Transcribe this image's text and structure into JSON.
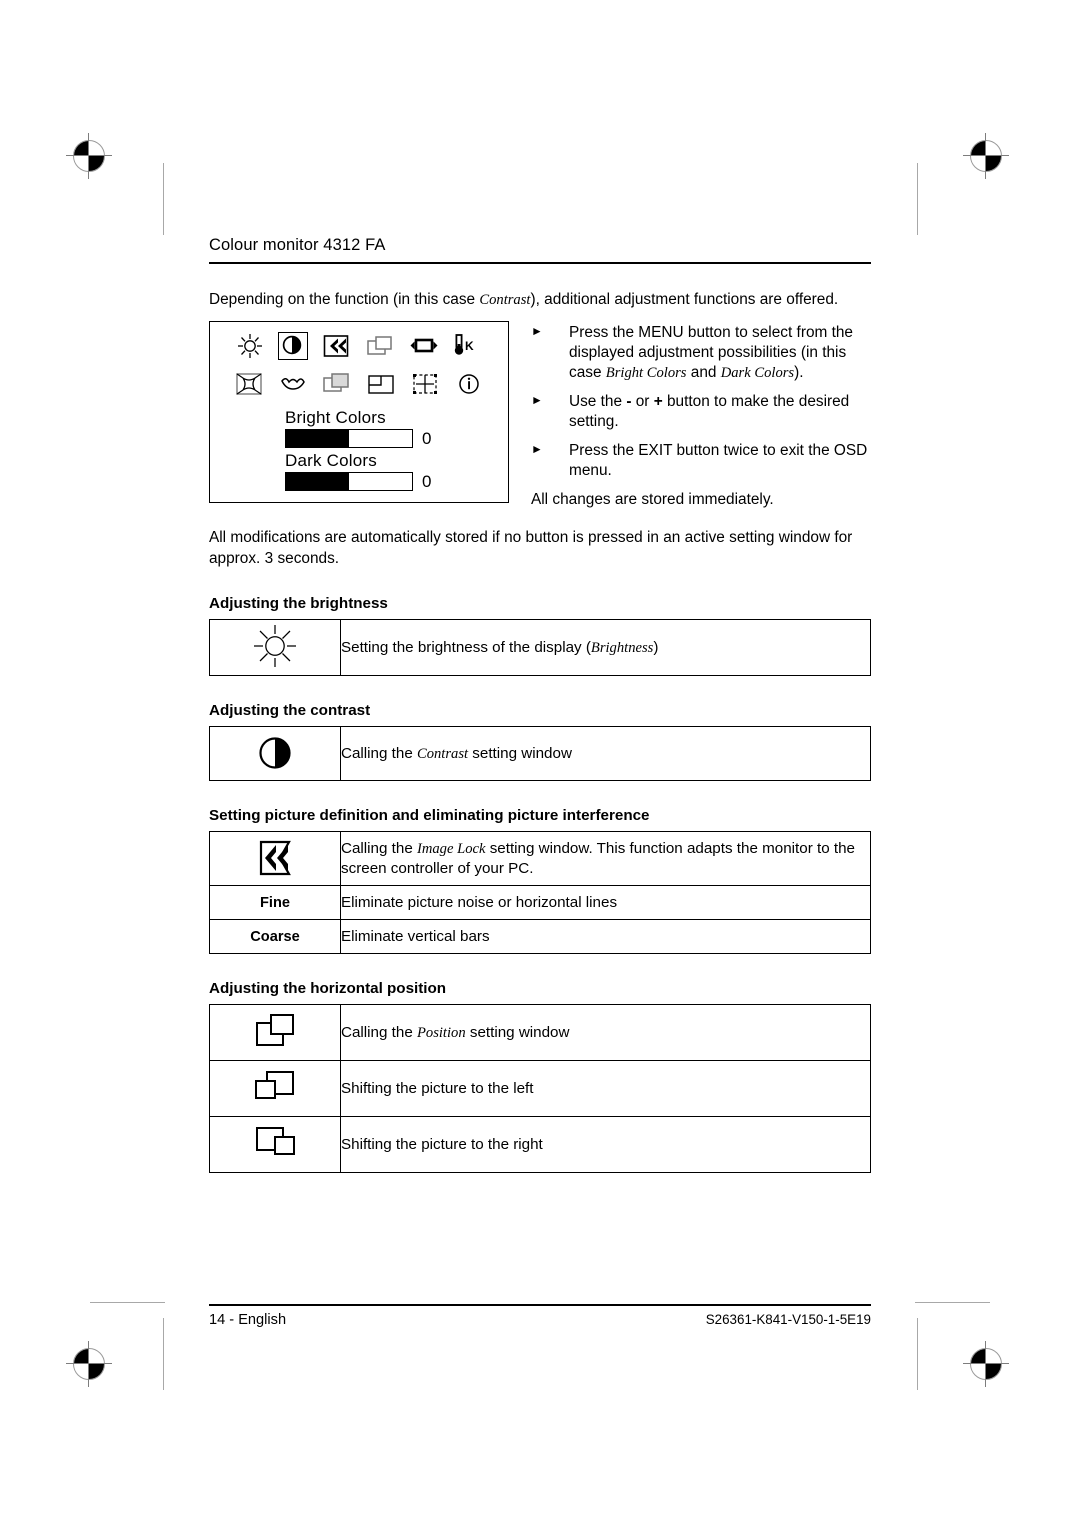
{
  "header": {
    "title": "Colour monitor 4312 FA"
  },
  "intro": {
    "before": "Depending on the function (in this case ",
    "italic": "Contrast",
    "after": "), additional adjustment functions are offered."
  },
  "osd": {
    "icons_row1": [
      "brightness-sun-icon",
      "contrast-half-circle-icon",
      "image-lock-chevron-icon",
      "position-overlap-icon",
      "horizontal-size-icon",
      "colour-temperature-icon"
    ],
    "icons_row1_selected": 1,
    "colour_temperature_label": "K",
    "icons_row2": [
      "pincushion-icon",
      "pillow-balance-icon",
      "osd-position-icon",
      "zoom-corner-icon",
      "convergence-icon",
      "information-icon"
    ],
    "information_label": "i",
    "sliders": [
      {
        "label": "Bright Colors",
        "value": "0",
        "fill_percent": 50
      },
      {
        "label": "Dark Colors",
        "value": "0",
        "fill_percent": 50
      }
    ]
  },
  "bullets": [
    {
      "marker": "►",
      "text_parts": [
        {
          "text": "Press the MENU button to select from the displayed adjustment possibilities (in this case ",
          "style": "normal"
        },
        {
          "text": "Bright Colors",
          "style": "italic"
        },
        {
          "text": " and ",
          "style": "normal"
        },
        {
          "text": "Dark Colors",
          "style": "italic"
        },
        {
          "text": ").",
          "style": "normal"
        }
      ]
    },
    {
      "marker": "►",
      "text_parts": [
        {
          "text": "Use the ",
          "style": "normal"
        },
        {
          "text": "-",
          "style": "bold"
        },
        {
          "text": " or ",
          "style": "normal"
        },
        {
          "text": "+",
          "style": "bold"
        },
        {
          "text": " button to make the desired setting.",
          "style": "normal"
        }
      ]
    },
    {
      "marker": "►",
      "text_parts": [
        {
          "text": "Press the EXIT button twice to exit the OSD menu.",
          "style": "normal"
        }
      ]
    }
  ],
  "osd_note": "All changes are stored immediately.",
  "storage_paragraph": "All modifications are automatically stored if no button is pressed in an active setting window for approx. 3 seconds.",
  "sections": [
    {
      "heading": "Adjusting the brightness",
      "rows": [
        {
          "kind": "icon",
          "icon": "brightness-sun-icon",
          "desc_parts": [
            {
              "text": "Setting the brightness of the display (",
              "style": "normal"
            },
            {
              "text": "Brightness",
              "style": "italic"
            },
            {
              "text": ")",
              "style": "normal"
            }
          ]
        }
      ]
    },
    {
      "heading": "Adjusting the contrast",
      "rows": [
        {
          "kind": "icon",
          "icon": "contrast-half-circle-icon",
          "desc_parts": [
            {
              "text": "Calling the ",
              "style": "normal"
            },
            {
              "text": "Contrast",
              "style": "italic"
            },
            {
              "text": " setting window",
              "style": "normal"
            }
          ]
        }
      ]
    },
    {
      "heading": "Setting picture definition and eliminating picture interference",
      "rows": [
        {
          "kind": "icon",
          "icon": "image-lock-chevron-icon",
          "desc_parts": [
            {
              "text": "Calling the ",
              "style": "normal"
            },
            {
              "text": "Image Lock",
              "style": "italic"
            },
            {
              "text": " setting window. This function adapts the monitor to the screen controller of your PC.",
              "style": "normal"
            }
          ]
        },
        {
          "kind": "label",
          "label": "Fine",
          "desc_parts": [
            {
              "text": "Eliminate picture noise or horizontal lines",
              "style": "normal"
            }
          ]
        },
        {
          "kind": "label",
          "label": "Coarse",
          "desc_parts": [
            {
              "text": "Eliminate vertical bars",
              "style": "normal"
            }
          ]
        }
      ]
    },
    {
      "heading": "Adjusting the horizontal position",
      "rows": [
        {
          "kind": "icon",
          "icon": "position-overlap-icon",
          "desc_parts": [
            {
              "text": "Calling the ",
              "style": "normal"
            },
            {
              "text": "Position",
              "style": "italic"
            },
            {
              "text": " setting window",
              "style": "normal"
            }
          ]
        },
        {
          "kind": "icon",
          "icon": "shift-left-icon",
          "desc_parts": [
            {
              "text": "Shifting the picture to the left",
              "style": "normal"
            }
          ]
        },
        {
          "kind": "icon",
          "icon": "shift-right-icon",
          "desc_parts": [
            {
              "text": "Shifting the picture to the right",
              "style": "normal"
            }
          ]
        }
      ]
    }
  ],
  "footer": {
    "page_label": "14 - English",
    "doc_code": "S26361-K841-V150-1-5E19"
  },
  "colors": {
    "ink": "#000000",
    "page": "#ffffff",
    "crop_mark": "#a8a8a8",
    "icon_gray": "#d9d9d9"
  }
}
